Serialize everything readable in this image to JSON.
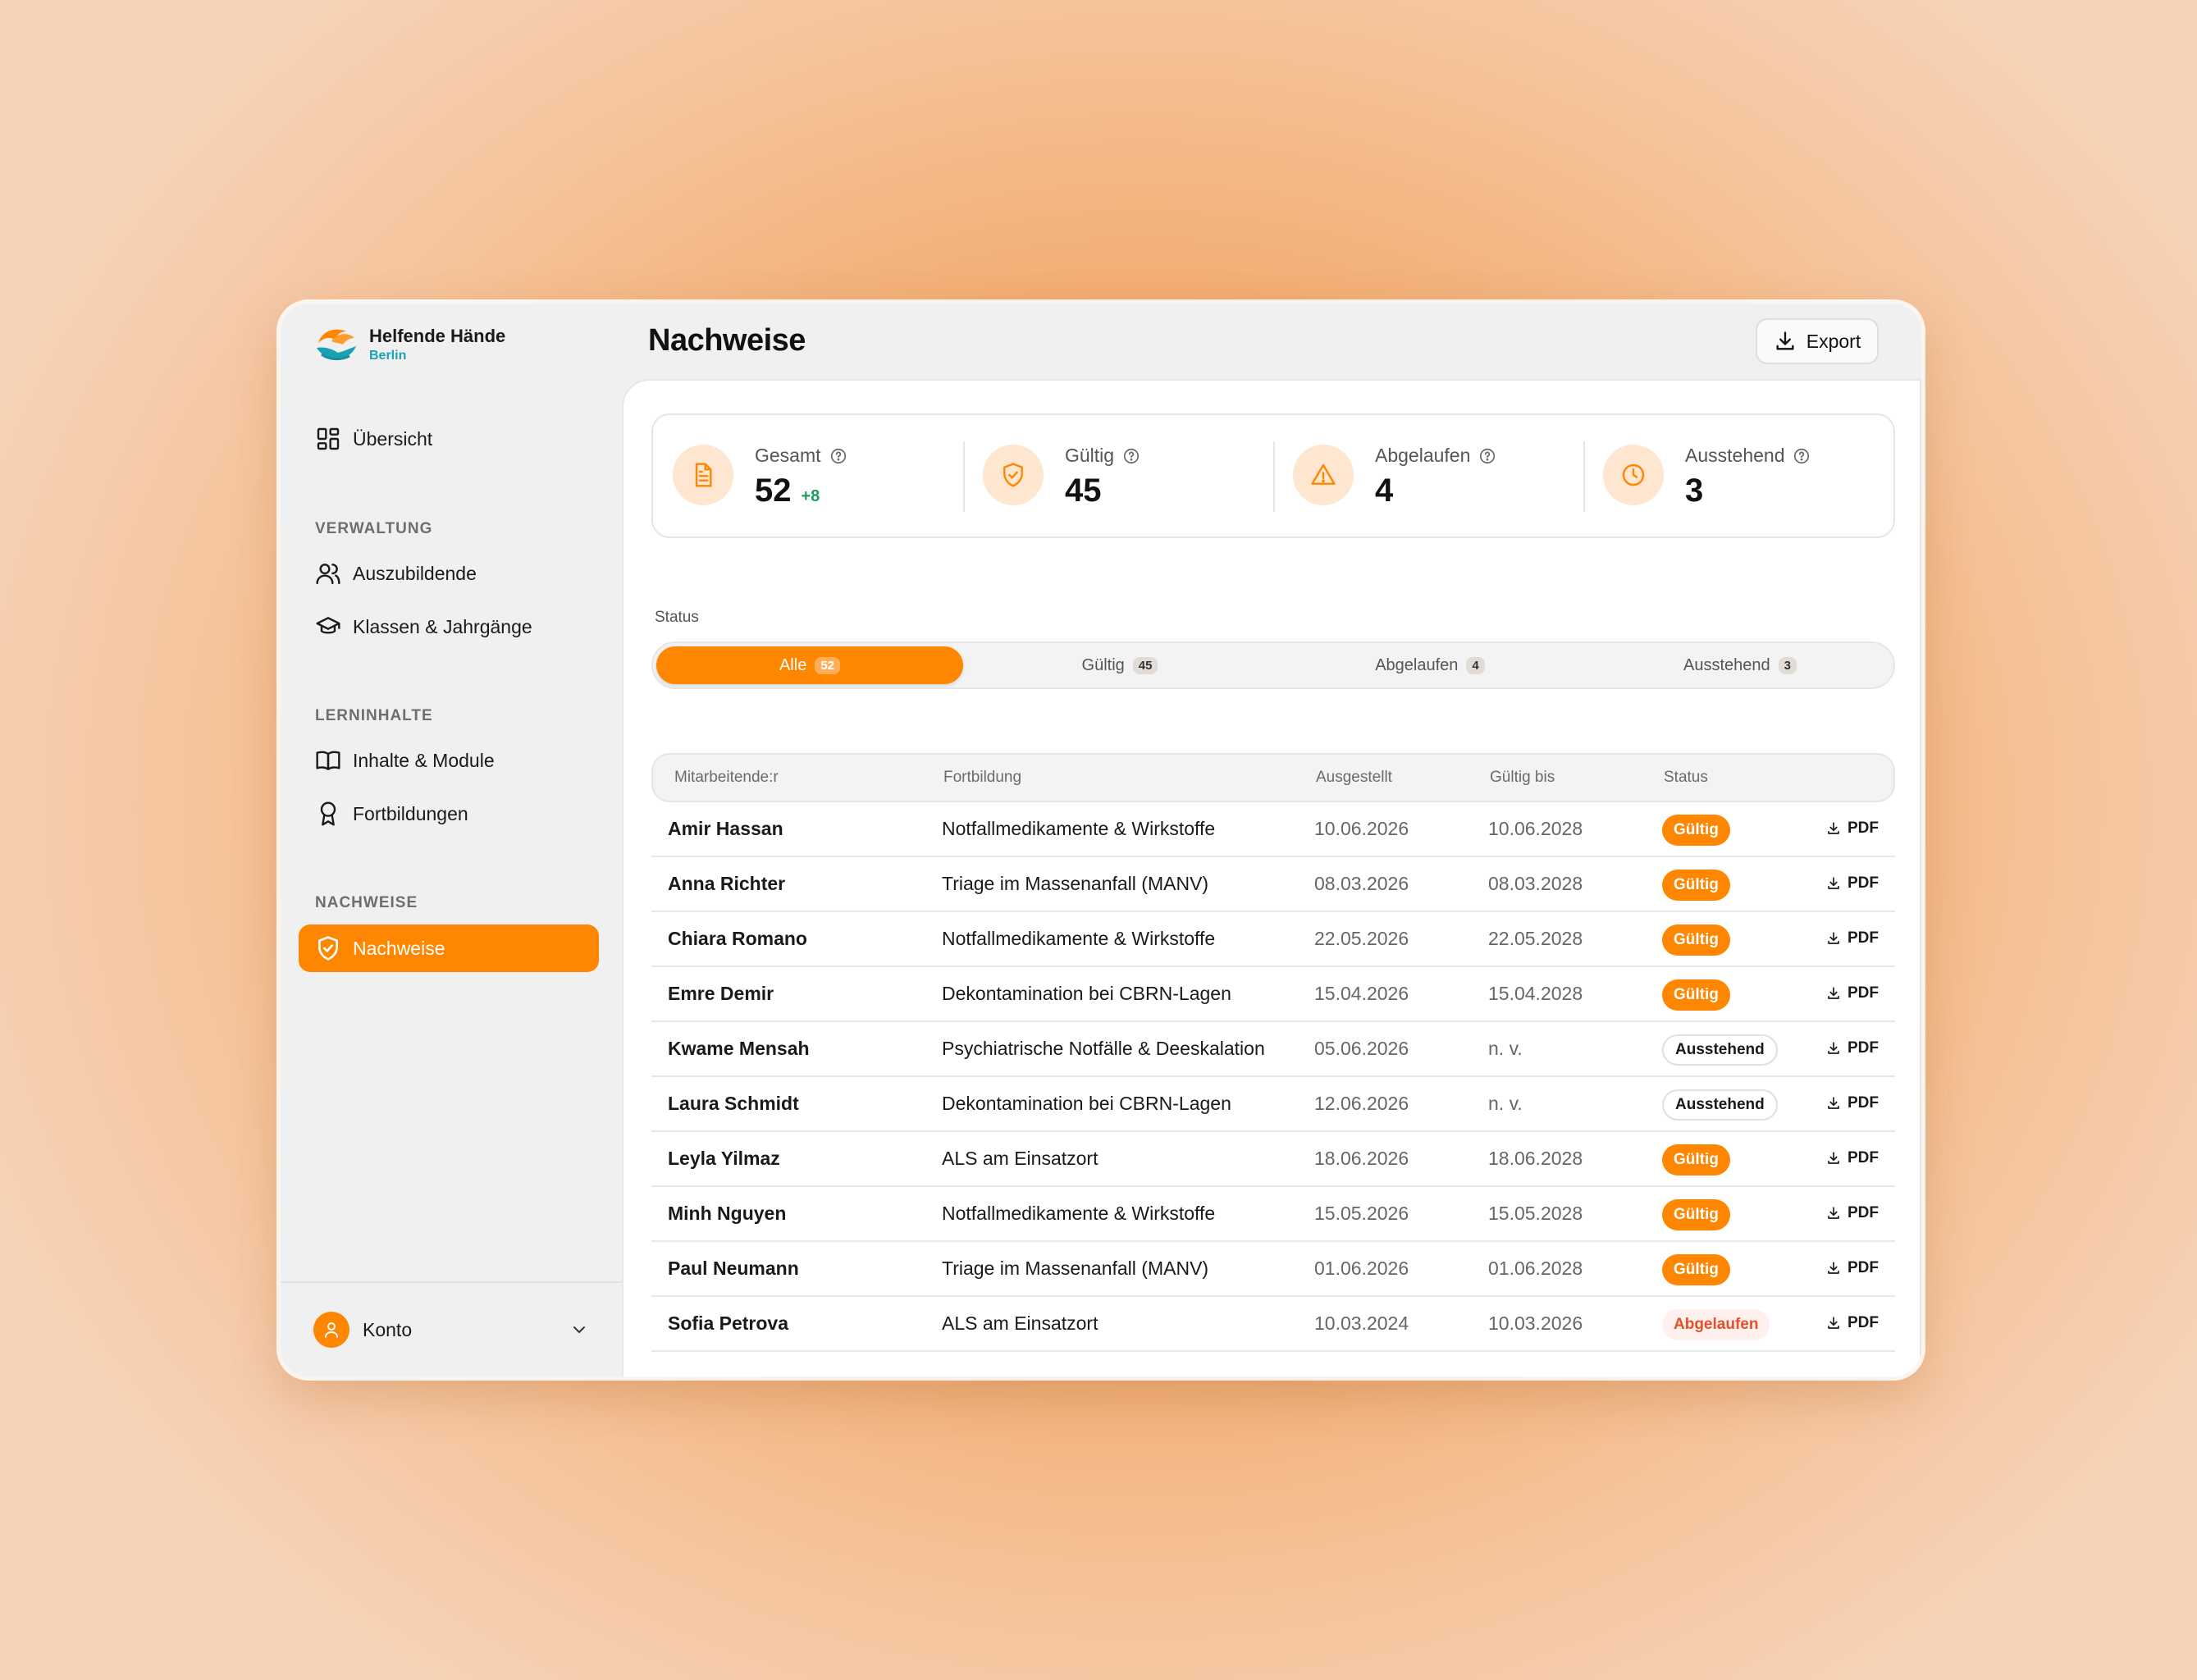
{
  "brand": {
    "name": "Helfende Hände",
    "sub": "Berlin"
  },
  "sidebar": {
    "overview": "Übersicht",
    "sections": [
      {
        "title": "VERWALTUNG",
        "items": [
          "Auszubildende",
          "Klassen & Jahrgänge"
        ]
      },
      {
        "title": "LERNINHALTE",
        "items": [
          "Inhalte & Module",
          "Fortbildungen"
        ]
      },
      {
        "title": "NACHWEISE",
        "items": [
          "Nachweise"
        ]
      }
    ],
    "account": "Konto"
  },
  "header": {
    "title": "Nachweise",
    "export_label": "Export"
  },
  "stats": [
    {
      "label": "Gesamt",
      "value": "52",
      "delta": "+8",
      "icon": "document-icon"
    },
    {
      "label": "Gültig",
      "value": "45",
      "delta": "",
      "icon": "shield-check-icon"
    },
    {
      "label": "Abgelaufen",
      "value": "4",
      "delta": "",
      "icon": "warning-icon"
    },
    {
      "label": "Ausstehend",
      "value": "3",
      "delta": "",
      "icon": "clock-icon"
    }
  ],
  "filter": {
    "label": "Status",
    "options": [
      {
        "label": "Alle",
        "count": "52",
        "active": true
      },
      {
        "label": "Gültig",
        "count": "45",
        "active": false
      },
      {
        "label": "Abgelaufen",
        "count": "4",
        "active": false
      },
      {
        "label": "Ausstehend",
        "count": "3",
        "active": false
      }
    ]
  },
  "table": {
    "columns": [
      "Mitarbeitende:r",
      "Fortbildung",
      "Ausgestellt",
      "Gültig bis",
      "Status"
    ],
    "pdf_label": "PDF",
    "rows": [
      {
        "name": "Amir Hassan",
        "course": "Notfallmedikamente & Wirkstoffe",
        "issued": "10.06.2026",
        "valid_until": "10.06.2028",
        "status": "Gültig",
        "type": "valid"
      },
      {
        "name": "Anna Richter",
        "course": "Triage im Massenanfall (MANV)",
        "issued": "08.03.2026",
        "valid_until": "08.03.2028",
        "status": "Gültig",
        "type": "valid"
      },
      {
        "name": "Chiara Romano",
        "course": "Notfallmedikamente & Wirkstoffe",
        "issued": "22.05.2026",
        "valid_until": "22.05.2028",
        "status": "Gültig",
        "type": "valid"
      },
      {
        "name": "Emre Demir",
        "course": "Dekontamination bei CBRN-Lagen",
        "issued": "15.04.2026",
        "valid_until": "15.04.2028",
        "status": "Gültig",
        "type": "valid"
      },
      {
        "name": "Kwame Mensah",
        "course": "Psychiatrische Notfälle & Deeskalation",
        "issued": "05.06.2026",
        "valid_until": "n. v.",
        "status": "Ausstehend",
        "type": "pending"
      },
      {
        "name": "Laura Schmidt",
        "course": "Dekontamination bei CBRN-Lagen",
        "issued": "12.06.2026",
        "valid_until": "n. v.",
        "status": "Ausstehend",
        "type": "pending"
      },
      {
        "name": "Leyla Yilmaz",
        "course": "ALS am Einsatzort",
        "issued": "18.06.2026",
        "valid_until": "18.06.2028",
        "status": "Gültig",
        "type": "valid"
      },
      {
        "name": "Minh Nguyen",
        "course": "Notfallmedikamente & Wirkstoffe",
        "issued": "15.05.2026",
        "valid_until": "15.05.2028",
        "status": "Gültig",
        "type": "valid"
      },
      {
        "name": "Paul Neumann",
        "course": "Triage im Massenanfall (MANV)",
        "issued": "01.06.2026",
        "valid_until": "01.06.2028",
        "status": "Gültig",
        "type": "valid"
      },
      {
        "name": "Sofia Petrova",
        "course": "ALS am Einsatzort",
        "issued": "10.03.2024",
        "valid_until": "10.03.2026",
        "status": "Abgelaufen",
        "type": "expired"
      }
    ]
  },
  "colors": {
    "accent": "#ff8600",
    "teal": "#1aa2b4",
    "positive": "#1a9e5a",
    "danger": "#e4502a"
  }
}
